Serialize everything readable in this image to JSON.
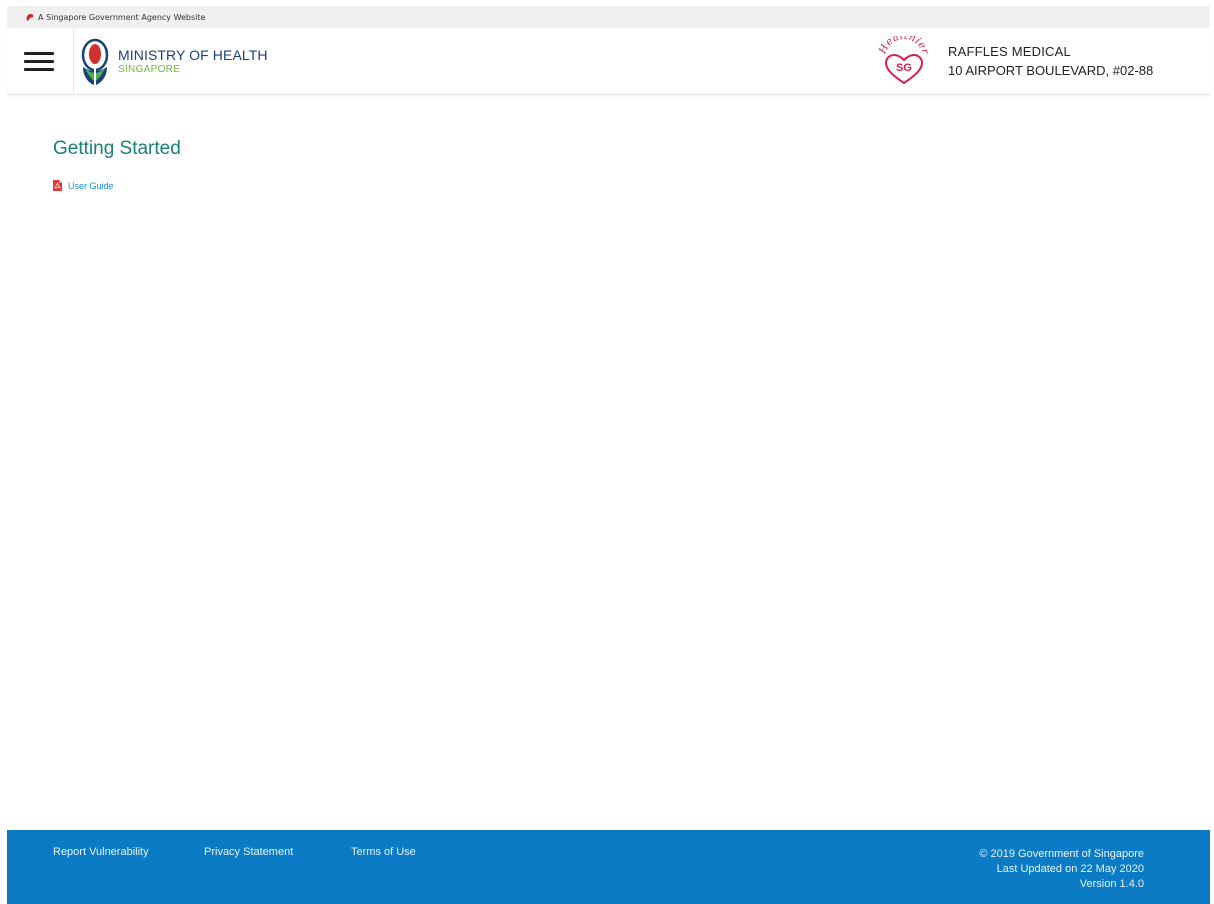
{
  "gov_bar": {
    "text": "A Singapore Government Agency Website"
  },
  "header": {
    "agency_title": "MINISTRY OF HEALTH",
    "agency_subtitle": "SINGAPORE",
    "clinic_name": "RAFFLES MEDICAL",
    "clinic_address": "10 AIRPORT BOULEVARD, #02-88"
  },
  "main": {
    "title": "Getting Started",
    "user_guide_label": "User Guide"
  },
  "footer": {
    "links": [
      "Report Vulnerability",
      "Privacy Statement",
      "Terms of Use"
    ],
    "copyright": "© 2019 Government of Singapore",
    "last_updated": "Last Updated on 22 May 2020",
    "version": "Version 1.4.0"
  },
  "colors": {
    "title_teal": "#1a7f74",
    "link_blue": "#1a8fd6",
    "footer_blue": "#0a7bc4",
    "moh_navy": "#1b3f78",
    "moh_green": "#7cb342",
    "healthier_sg_red": "#d81b4a"
  },
  "icons": [
    "lion-head-icon",
    "hamburger-menu-icon",
    "moh-logo-icon",
    "healthier-sg-logo-icon",
    "pdf-icon"
  ]
}
